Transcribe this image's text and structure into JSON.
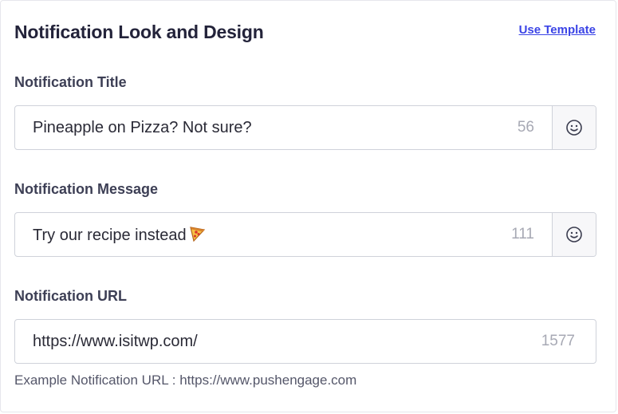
{
  "header": {
    "title": "Notification Look and Design",
    "use_template_label": "Use Template"
  },
  "fields": {
    "title": {
      "label": "Notification Title",
      "value": "Pineapple on Pizza? Not sure?",
      "counter": "56",
      "emoji_icon": "smiley-icon"
    },
    "message": {
      "label": "Notification Message",
      "value": "Try our recipe instead",
      "trailing_emoji": "pizza-emoji",
      "counter": "111",
      "emoji_icon": "smiley-icon"
    },
    "url": {
      "label": "Notification URL",
      "value": "https://www.isitwp.com/",
      "counter": "1577"
    }
  },
  "hint": {
    "text": "Example Notification URL : https://www.pushengage.com"
  },
  "colors": {
    "accent_link": "#3b44e6",
    "border": "#cfd2da",
    "counter": "#a7a9b4"
  }
}
